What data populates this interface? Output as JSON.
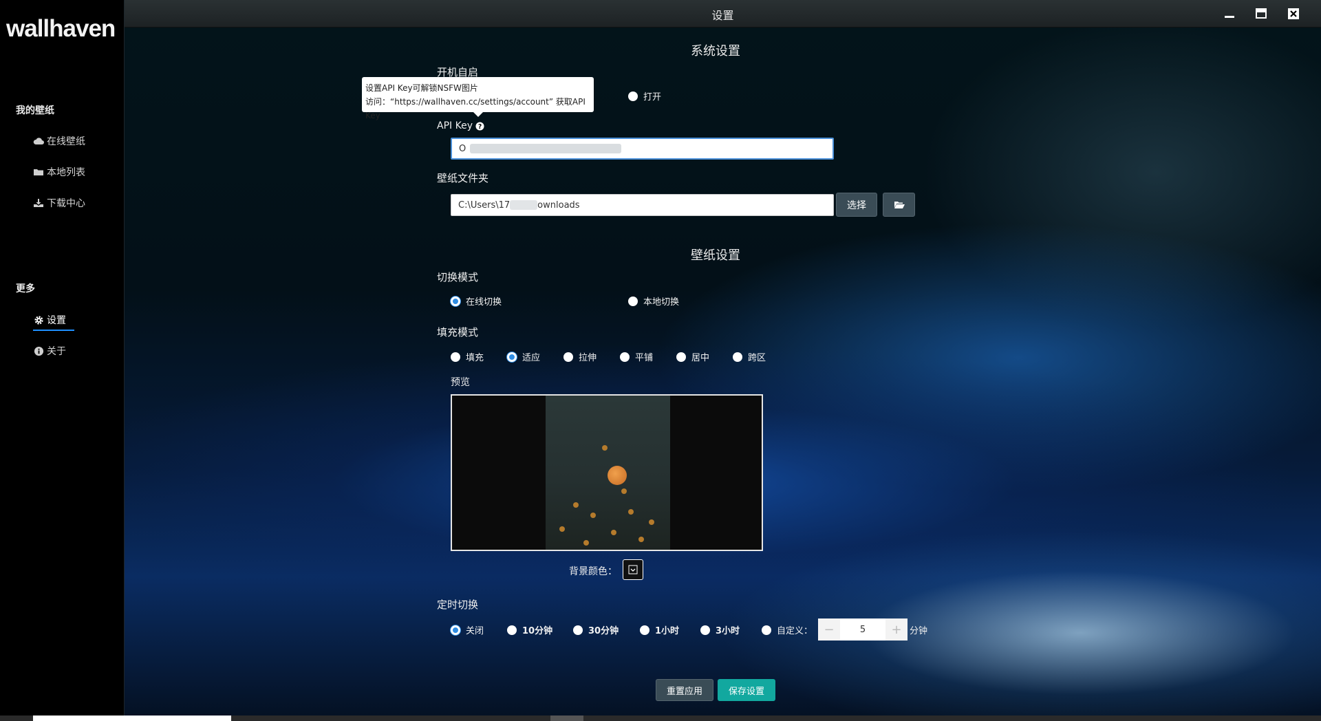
{
  "app": {
    "logo": "wallhaven",
    "window_title": "设置"
  },
  "sidebar": {
    "section_wallpapers": "我的壁纸",
    "items_wallpapers": [
      {
        "label": "在线壁纸",
        "icon": "cloud-icon"
      },
      {
        "label": "本地列表",
        "icon": "folder-icon"
      },
      {
        "label": "下载中心",
        "icon": "download-icon"
      }
    ],
    "section_more": "更多",
    "items_more": [
      {
        "label": "设置",
        "icon": "gear-icon",
        "active": true
      },
      {
        "label": "关于",
        "icon": "info-icon"
      }
    ]
  },
  "system": {
    "title": "系统设置",
    "autostart_label": "开机自启",
    "autostart_on": "打开",
    "tooltip_line1": "设置API Key可解锁NSFW图片",
    "tooltip_line2": "访问：“https://wallhaven.cc/settings/account” 获取API Key",
    "apikey_label": "API Key",
    "apikey_prefix": "O",
    "folder_label": "壁纸文件夹",
    "folder_value_prefix": "C:\\Users\\17",
    "folder_value_suffix": "ownloads",
    "select_button": "选择"
  },
  "wallpaper": {
    "title": "壁纸设置",
    "switch_mode_label": "切换模式",
    "switch_options": [
      "在线切换",
      "本地切换"
    ],
    "switch_selected": "在线切换",
    "fill_mode_label": "填充模式",
    "fill_options": [
      "填充",
      "适应",
      "拉伸",
      "平铺",
      "居中",
      "跨区"
    ],
    "fill_selected": "适应",
    "preview_label": "预览",
    "bg_color_label": "背景颜色：",
    "timer_label": "定时切换",
    "timer_options": [
      "关闭",
      "10分钟",
      "30分钟",
      "1小时",
      "3小时",
      "自定义："
    ],
    "timer_selected": "关闭",
    "custom_value": "5",
    "custom_unit": "分钟",
    "reset_button": "重置应用",
    "save_button": "保存设置"
  },
  "colors": {
    "accent": "#2f8de4",
    "save_button": "#12a89f",
    "select_button": "#3a4c56"
  }
}
